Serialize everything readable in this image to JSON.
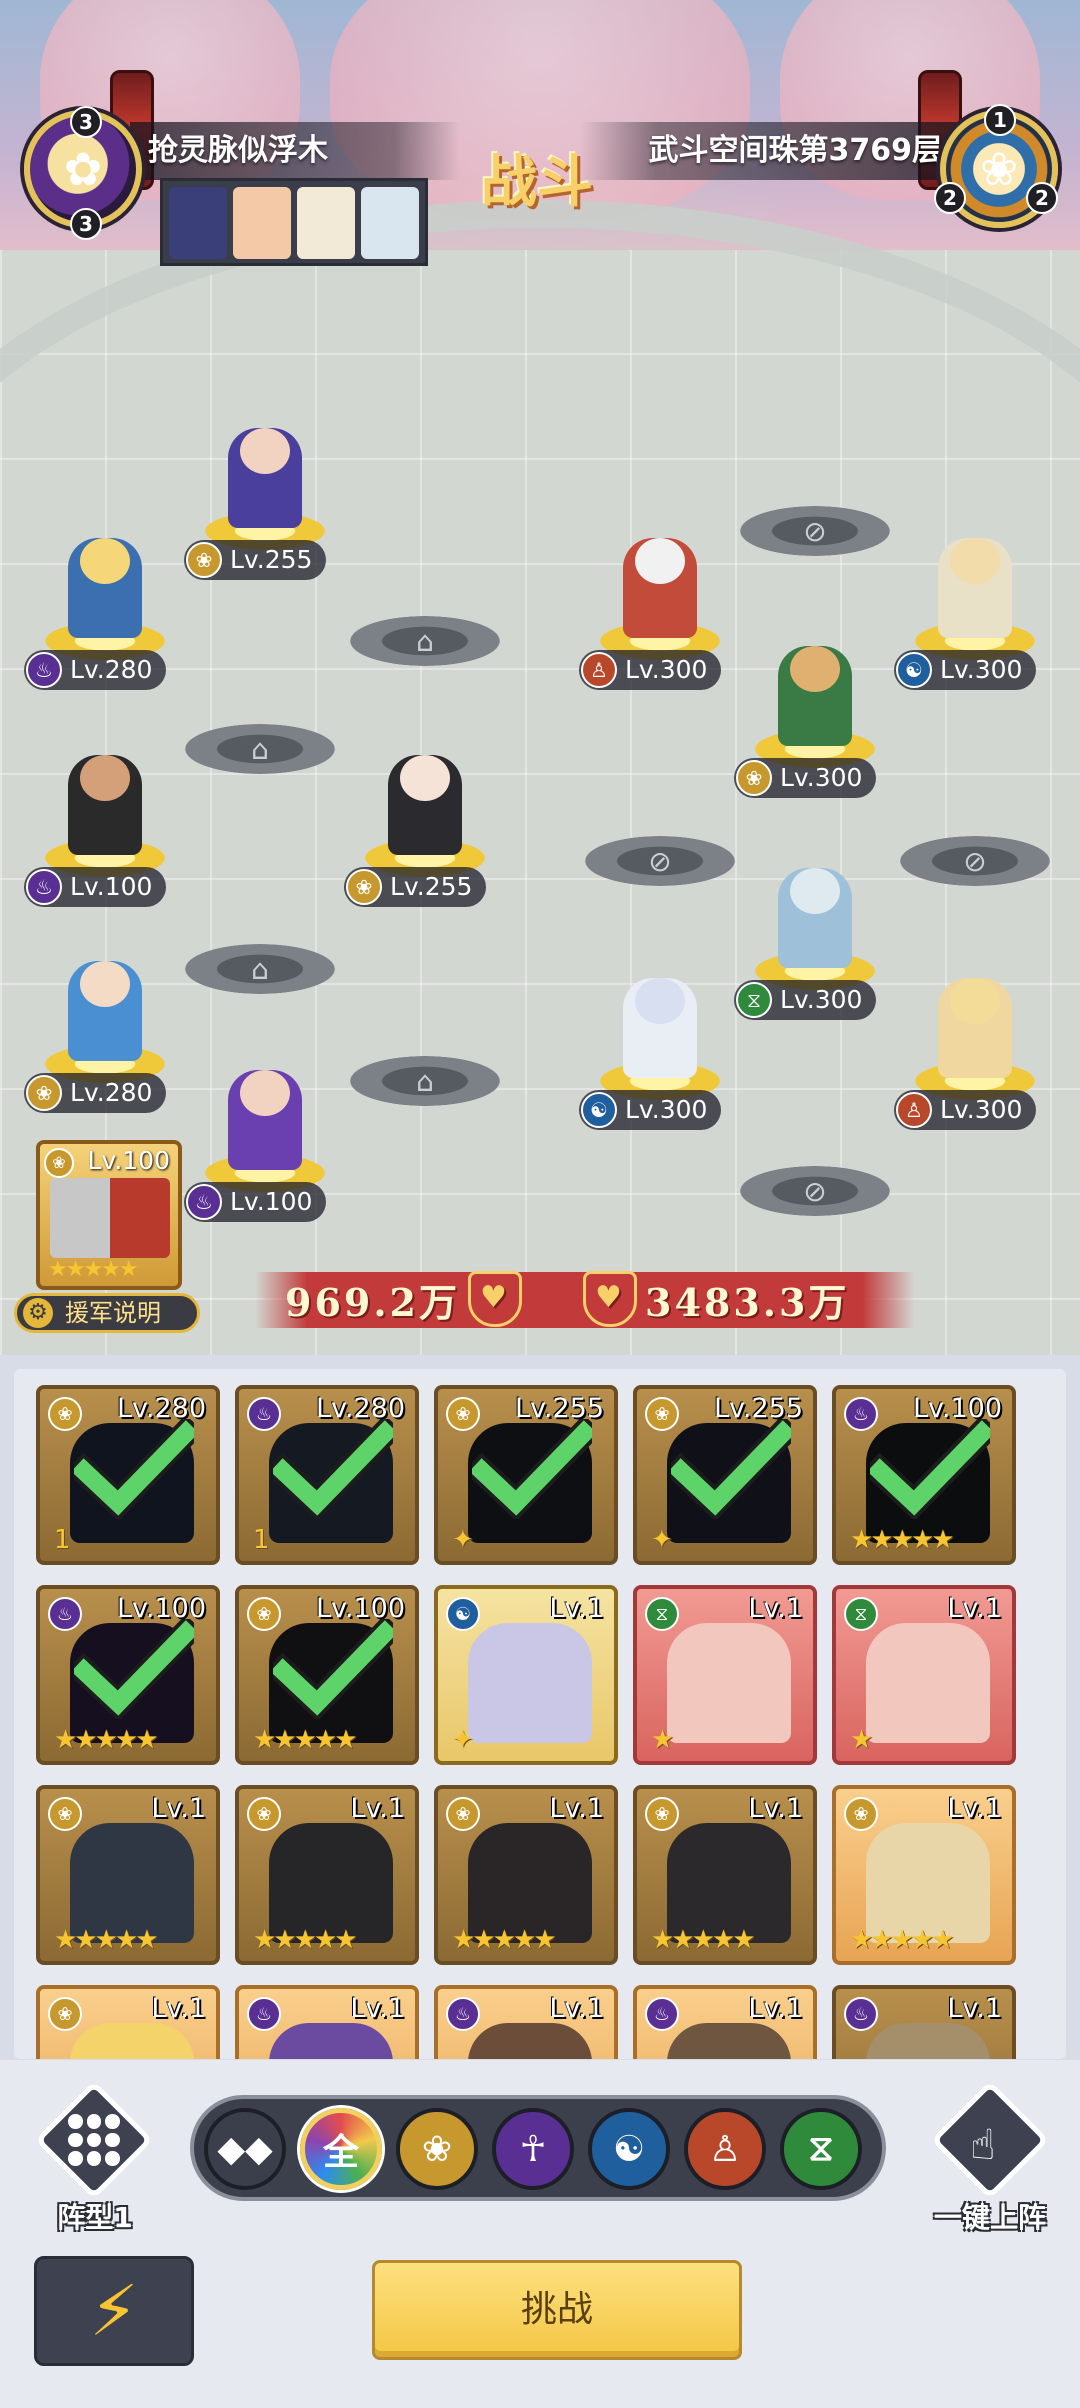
{
  "header": {
    "left_title": "抢灵脉似浮木",
    "right_title": "武斗空间珠第3769层",
    "battle_sign": "战斗",
    "left_counts": [
      "3",
      "3"
    ],
    "right_counts": [
      "1",
      "2",
      "2"
    ]
  },
  "field": {
    "player_units": [
      {
        "level": "Lv.255",
        "class": "lotus",
        "color": "#4b3f9e"
      },
      {
        "level": "Lv.280",
        "class": "flame",
        "color": "#3b6fb0"
      },
      {
        "level": "Lv.100",
        "class": "flame",
        "color": "#2a2a2a"
      },
      {
        "level": "Lv.255",
        "class": "lotus",
        "color": "#2b2b2f"
      },
      {
        "level": "Lv.280",
        "class": "lotus",
        "color": "#4a8fd1"
      },
      {
        "level": "Lv.100",
        "class": "flame",
        "color": "#6a3fb0"
      }
    ],
    "enemy_units": [
      {
        "level": "Lv.300",
        "class": "monk",
        "color": "#c24b3a"
      },
      {
        "level": "Lv.300",
        "class": "wave",
        "color": "#e8e1c8"
      },
      {
        "level": "Lv.300",
        "class": "lotus",
        "color": "#3a7a45"
      },
      {
        "level": "Lv.300",
        "class": "dna",
        "color": "#9ec1d9"
      },
      {
        "level": "Lv.300",
        "class": "wave",
        "color": "#e9eef5"
      },
      {
        "level": "Lv.300",
        "class": "monk",
        "color": "#f0d7a0"
      }
    ],
    "reinforcement": {
      "level": "Lv.100",
      "stars": "★★★★★",
      "help_label": "援军说明"
    },
    "power_left": "969.2万",
    "power_right": "3483.3万",
    "icons": {
      "lock": "lock-icon",
      "blocked": "blocked-icon",
      "shield": "shield-icon"
    }
  },
  "roster": {
    "cards": [
      {
        "level": "Lv.280",
        "class": "lotus",
        "selected": true,
        "style": "dim",
        "stars": "1"
      },
      {
        "level": "Lv.280",
        "class": "flame",
        "selected": true,
        "style": "dim",
        "stars": "1"
      },
      {
        "level": "Lv.255",
        "class": "lotus",
        "selected": true,
        "style": "dim",
        "stars": "✦"
      },
      {
        "level": "Lv.255",
        "class": "lotus",
        "selected": true,
        "style": "dim",
        "stars": "✦"
      },
      {
        "level": "Lv.100",
        "class": "flame",
        "selected": true,
        "style": "dim",
        "stars": "★★★★★"
      },
      {
        "level": "Lv.100",
        "class": "flame",
        "selected": true,
        "style": "dim",
        "stars": "★★★★★"
      },
      {
        "level": "Lv.100",
        "class": "lotus",
        "selected": true,
        "style": "dim",
        "stars": "★★★★★"
      },
      {
        "level": "Lv.1",
        "class": "wave",
        "selected": false,
        "style": "gold",
        "stars": "✦"
      },
      {
        "level": "Lv.1",
        "class": "dna",
        "selected": false,
        "style": "red",
        "stars": "★"
      },
      {
        "level": "Lv.1",
        "class": "dna",
        "selected": false,
        "style": "red",
        "stars": "★"
      },
      {
        "level": "Lv.1",
        "class": "lotus",
        "selected": false,
        "style": "brown",
        "stars": "★★★★★"
      },
      {
        "level": "Lv.1",
        "class": "lotus",
        "selected": false,
        "style": "brown",
        "stars": "★★★★★"
      },
      {
        "level": "Lv.1",
        "class": "lotus",
        "selected": false,
        "style": "brown",
        "stars": "★★★★★"
      },
      {
        "level": "Lv.1",
        "class": "lotus",
        "selected": false,
        "style": "brown",
        "stars": "★★★★★"
      },
      {
        "level": "Lv.1",
        "class": "lotus",
        "selected": false,
        "style": "peach",
        "stars": "★★★★★"
      },
      {
        "level": "Lv.1",
        "class": "lotus",
        "selected": false,
        "style": "peach",
        "stars": ""
      },
      {
        "level": "Lv.1",
        "class": "flame",
        "selected": false,
        "style": "peach",
        "stars": ""
      },
      {
        "level": "Lv.1",
        "class": "flame",
        "selected": false,
        "style": "peach",
        "stars": ""
      },
      {
        "level": "Lv.1",
        "class": "flame",
        "selected": false,
        "style": "peach",
        "stars": ""
      },
      {
        "level": "Lv.1",
        "class": "flame",
        "selected": false,
        "style": "brown",
        "stars": ""
      }
    ]
  },
  "controls": {
    "formation_label": "阵型1",
    "onekey_label": "一键上阵",
    "challenge_label": "挑战",
    "filters": [
      {
        "name": "filter-swap",
        "label": "◆◆"
      },
      {
        "name": "filter-all",
        "label": "全",
        "active": true
      },
      {
        "name": "filter-lotus",
        "label": "❀"
      },
      {
        "name": "filter-flame",
        "label": "☥"
      },
      {
        "name": "filter-wave",
        "label": "☯"
      },
      {
        "name": "filter-monk",
        "label": "♙"
      },
      {
        "name": "filter-dna",
        "label": "⧖"
      }
    ]
  },
  "colors": {
    "lotus": "#c7982d",
    "flame": "#5a2f93",
    "wave": "#1f5f9e",
    "monk": "#b9482a",
    "dna": "#2f8a3b",
    "check": "#5ed36a",
    "accent_gold": "#f7c531"
  }
}
